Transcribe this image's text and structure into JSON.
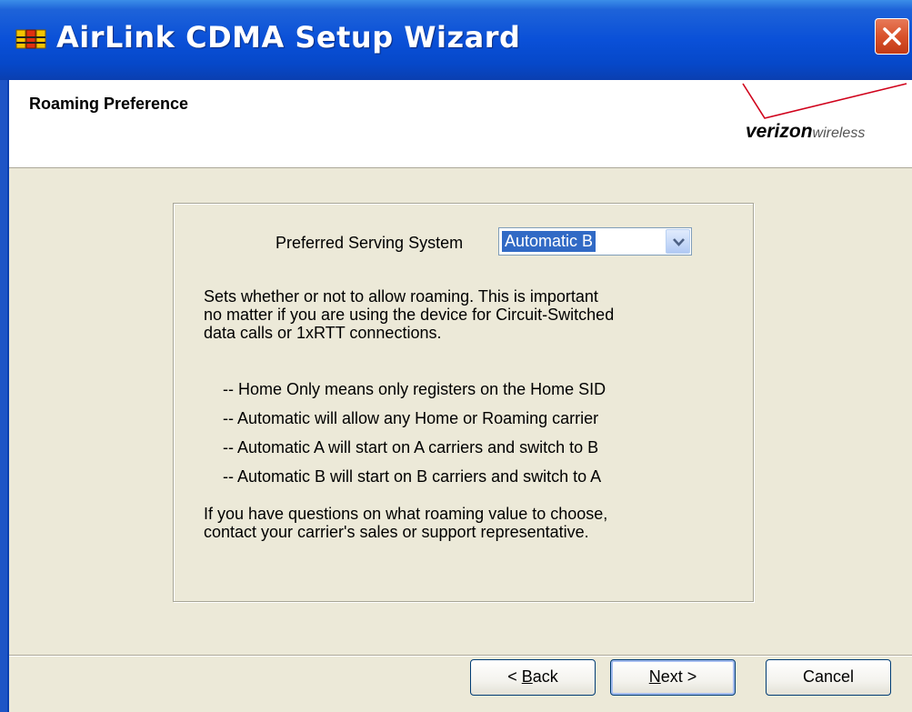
{
  "window": {
    "title": "AirLink CDMA Setup Wizard"
  },
  "header": {
    "title": "Roaming Preference",
    "logo": {
      "brand_bold": "verizon",
      "brand_light": "wireless"
    }
  },
  "roaming": {
    "label": "Preferred Serving System",
    "selected": "Automatic B",
    "description_lines": [
      "Sets whether or not to allow roaming. This is important",
      "no matter if you are using the device for Circuit-Switched",
      "data calls or 1xRTT connections."
    ],
    "options_help": [
      "-- Home Only means only registers on the Home SID",
      "-- Automatic will allow any Home or Roaming carrier",
      "-- Automatic A will start on A carriers and switch to B",
      "-- Automatic B will start on B carriers and switch to A"
    ],
    "footer_lines": [
      "If you have questions on what roaming value to choose,",
      "contact your carrier's sales or support representative."
    ]
  },
  "buttons": {
    "back": {
      "prefix": "< ",
      "mnemonic": "B",
      "rest": "ack"
    },
    "next": {
      "mnemonic": "N",
      "rest": "ext >"
    },
    "cancel": "Cancel"
  },
  "colors": {
    "titlebar": "#0a50d8",
    "selection": "#316ac5",
    "dialog_bg": "#ece9d8",
    "logo_red": "#d0021b"
  }
}
